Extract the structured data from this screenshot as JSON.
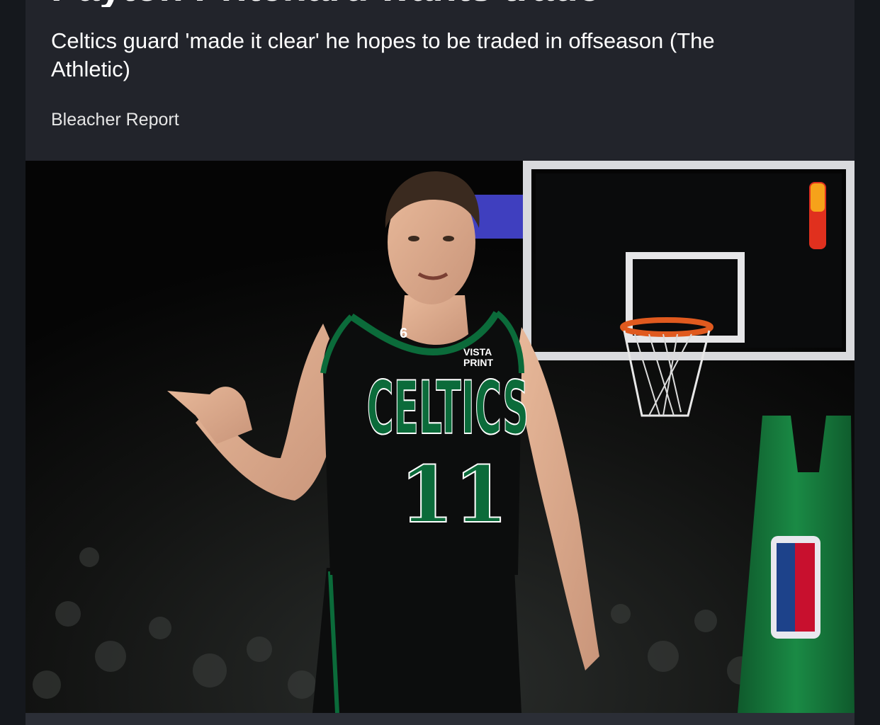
{
  "article": {
    "headline": "Payton Pritchard wants trade",
    "summary": "Celtics guard 'made it clear' he hopes to be traded in offseason (The Athletic)",
    "source": "Bleacher Report"
  },
  "photo": {
    "jersey_number": "11",
    "jersey_team": "CELTICS",
    "sponsor_line1": "VISTA",
    "sponsor_line2": "PRINT",
    "patch_number": "6"
  },
  "colors": {
    "card_background": "#22242b",
    "page_background": "#15181d",
    "celtics_green": "#0b6b3a",
    "text": "#ffffff"
  }
}
